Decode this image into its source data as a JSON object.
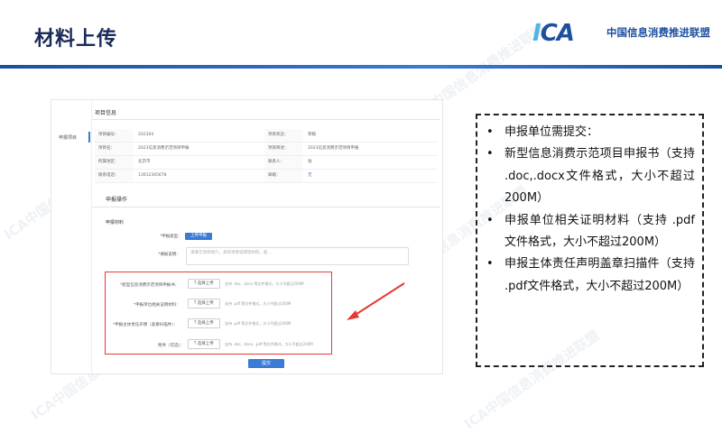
{
  "slide": {
    "title": "材料上传",
    "logo_text": "中国信息消费推进联盟",
    "logo_mark": "ICA",
    "watermark": "ICA中国信息消费推进联盟"
  },
  "screen": {
    "nav_item": "申报项目",
    "section1_title": "项目信息",
    "info_rows": [
      [
        "项目编号：",
        "202304",
        "项目状态：",
        "草稿"
      ],
      [
        "项目名：",
        "2023信息消费示范项目申报",
        "项目简述：",
        "2023信息消费示范项目申报"
      ],
      [
        "所属地区：",
        "北京市",
        "联系人：",
        "张"
      ],
      [
        "联系电话：",
        "13012345678",
        "邮箱：",
        "无"
      ]
    ],
    "section2_title": "申报操作",
    "subsection_title": "申报材料",
    "declare_type_label": "申报类型：",
    "declare_type_value": "上传申报",
    "remark_label": "填报说明：",
    "remark_placeholder": "请填写项目简介，具有项目说明等材料，能...",
    "uploads": [
      {
        "label": "新型信息消费示范项目申报书：",
        "button": "选择上传",
        "hint": "支持 .doc, .docx 等文件格式，大小不超过200M"
      },
      {
        "label": "申报单位相关证明材料：",
        "button": "选择上传",
        "hint": "支持 .pdf 等文件格式，大小不超过200M"
      },
      {
        "label": "申报主体责任声明（盖章扫描件）：",
        "button": "选择上传",
        "hint": "支持 .pdf 等文件格式，大小不超过200M"
      },
      {
        "label": "附件（可选）：",
        "button": "选择上传",
        "hint": "支持 .doc, .docx, .pdf 等文件格式，大小不超过200M"
      }
    ],
    "submit_label": "提交"
  },
  "callout": {
    "items": [
      "申报单位需提交：",
      "新型信息消费示范项目申报书（支持 .doc,.docx文件格式，大小不超过200M）",
      "申报单位相关证明材料（支持 .pdf文件格式，大小不超过200M）",
      "申报主体责任声明盖章扫描件（支持 .pdf文件格式，大小不超过200M）"
    ]
  },
  "colors": {
    "accent": "#3a7bd5",
    "title": "#1a2a5a",
    "highlight": "#e53935",
    "logo": "#1d4f9e"
  }
}
